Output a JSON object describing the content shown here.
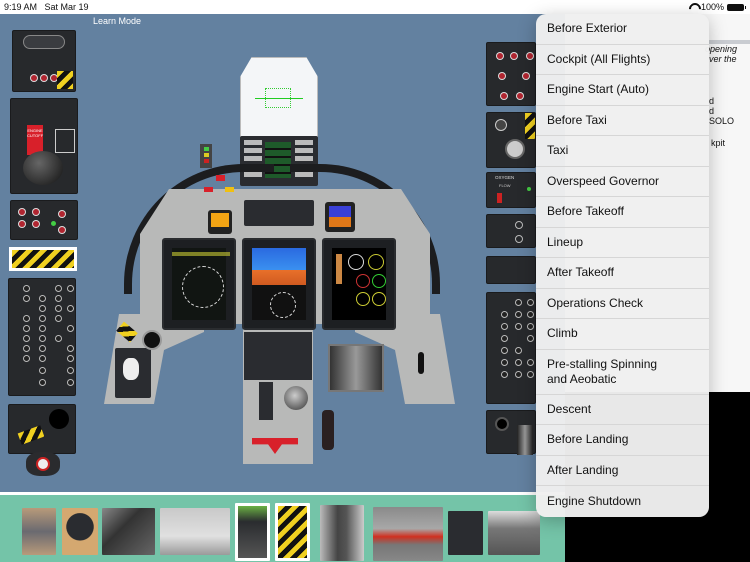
{
  "status_bar": {
    "time": "9:19 AM",
    "date": "Sat Mar 19",
    "battery": "100%",
    "wifi_icon": "wifi-icon",
    "battery_icon": "battery-icon"
  },
  "cockpit": {
    "mode_label": "Learn Mode",
    "panel_labels": {
      "engine_cutoff": "ENGINE CUTOFF",
      "oxygen": "OXYGEN",
      "oxygen_flow": "FLOW"
    }
  },
  "info_panel": {
    "lines": [
      " opening",
      "ver the",
      "d",
      "d",
      "SOLO",
      "kpit"
    ]
  },
  "checklist_menu": {
    "items": [
      {
        "label": "Before Exterior"
      },
      {
        "label": "Cockpit (All Flights)"
      },
      {
        "label": "Engine Start (Auto)"
      },
      {
        "label": "Before Taxi"
      },
      {
        "label": "Taxi"
      },
      {
        "label": "Overspeed Governor"
      },
      {
        "label": "Before Takeoff"
      },
      {
        "label": "Lineup"
      },
      {
        "label": "After Takeoff"
      },
      {
        "label": "Operations Check"
      },
      {
        "label": "Climb"
      },
      {
        "label": "Pre-stalling Spinning and Aeobatic"
      },
      {
        "label": "Descent"
      },
      {
        "label": "Before Landing"
      },
      {
        "label": "After Landing"
      },
      {
        "label": "Engine Shutdown"
      }
    ]
  },
  "thumbnails": [
    {
      "name": "ejection-seat-harness",
      "selected": false
    },
    {
      "name": "flight-helmet",
      "selected": false
    },
    {
      "name": "canopy-handle",
      "selected": false
    },
    {
      "name": "ground-power-cart",
      "selected": false
    },
    {
      "name": "cockpit-seat",
      "selected": true
    },
    {
      "name": "ejection-handle-panel",
      "selected": true
    },
    {
      "name": "cockpit-interior",
      "selected": false
    },
    {
      "name": "aircraft-exterior",
      "selected": false
    },
    {
      "name": "circuit-breaker-panel",
      "selected": false
    },
    {
      "name": "canopy-frame",
      "selected": false
    }
  ],
  "colors": {
    "cockpit_bg": "#6381a0",
    "strip_bg": "#74c4a8",
    "hazard_yellow": "#f0d020",
    "warning_red": "#d8202a"
  }
}
